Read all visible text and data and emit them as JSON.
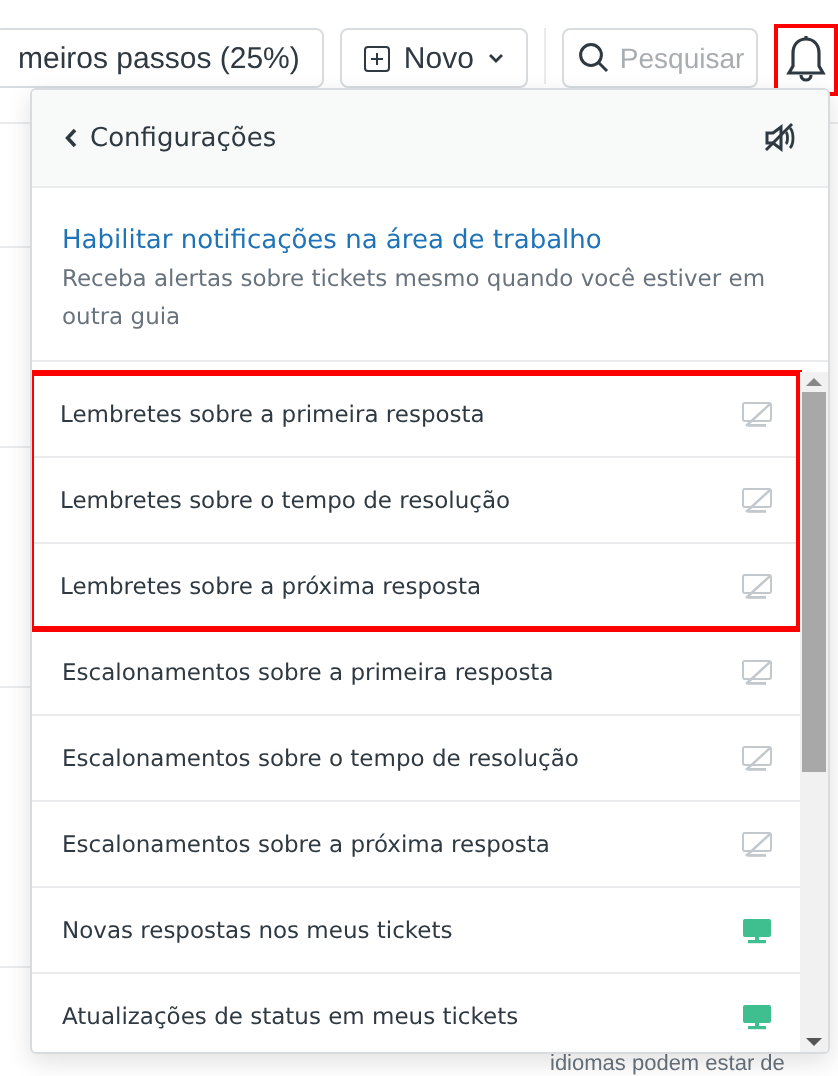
{
  "topbar": {
    "guide_button": "meiros passos (25%)",
    "new_button": "Novo",
    "search": {
      "placeholder": "Pesquisar"
    },
    "bell": {
      "highlighted": true
    }
  },
  "panel": {
    "back_label": "Configurações",
    "muted": true,
    "desktop": {
      "link": "Habilitar notificações na área de trabalho",
      "description": "Receba alertas sobre tickets mesmo quando você estiver em outra guia"
    },
    "groups": [
      {
        "highlighted": true,
        "items": [
          {
            "label": "Lembretes sobre a primeira resposta",
            "enabled": false
          },
          {
            "label": "Lembretes sobre o tempo de resolução",
            "enabled": false
          },
          {
            "label": "Lembretes sobre a próxima resposta",
            "enabled": false
          }
        ]
      },
      {
        "highlighted": false,
        "items": [
          {
            "label": "Escalonamentos sobre a primeira resposta",
            "enabled": false
          },
          {
            "label": "Escalonamentos sobre o tempo de resolução",
            "enabled": false
          },
          {
            "label": "Escalonamentos sobre a próxima resposta",
            "enabled": false
          },
          {
            "label": "Novas respostas nos meus tickets",
            "enabled": true
          },
          {
            "label": "Atualizações de status em meus tickets",
            "enabled": true
          }
        ]
      }
    ]
  },
  "background_text": "idiomas podem estar de"
}
